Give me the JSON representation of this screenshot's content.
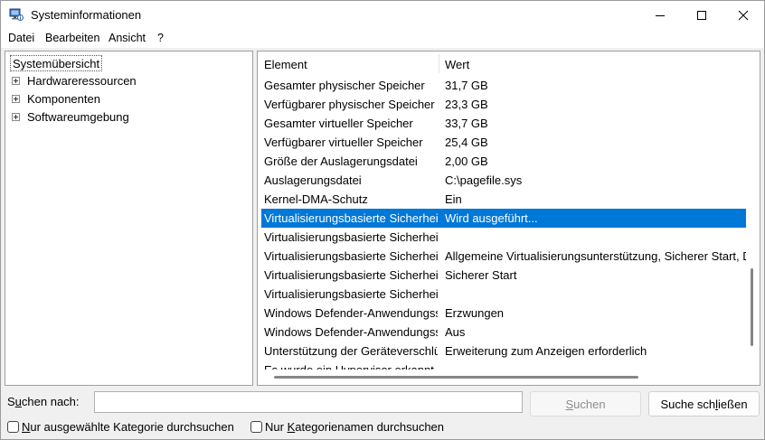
{
  "window": {
    "title": "Systeminformationen",
    "app_icon": "system-info-icon"
  },
  "menu": {
    "items": [
      "Datei",
      "Bearbeiten",
      "Ansicht",
      "?"
    ]
  },
  "tree": {
    "root": "Systemübersicht",
    "nodes": [
      "Hardwareressourcen",
      "Komponenten",
      "Softwareumgebung"
    ]
  },
  "list": {
    "columns": [
      "Element",
      "Wert"
    ],
    "rows": [
      {
        "element": "Gesamter physischer Speicher",
        "wert": "31,7 GB"
      },
      {
        "element": "Verfügbarer physischer Speicher",
        "wert": "23,3 GB"
      },
      {
        "element": "Gesamter virtueller Speicher",
        "wert": "33,7 GB"
      },
      {
        "element": "Verfügbarer virtueller Speicher",
        "wert": "25,4 GB"
      },
      {
        "element": "Größe der Auslagerungsdatei",
        "wert": "2,00 GB"
      },
      {
        "element": "Auslagerungsdatei",
        "wert": "C:\\pagefile.sys"
      },
      {
        "element": "Kernel-DMA-Schutz",
        "wert": "Ein"
      },
      {
        "element": "Virtualisierungsbasierte Sicherheit",
        "wert": "Wird ausgeführt..."
      },
      {
        "element": "Virtualisierungsbasierte Sicherheit",
        "wert": ""
      },
      {
        "element": "Virtualisierungsbasierte Sicherheit",
        "wert": "Allgemeine Virtualisierungsunterstützung, Sicherer Start, DMA-Schutz"
      },
      {
        "element": "Virtualisierungsbasierte Sicherheit",
        "wert": "Sicherer Start"
      },
      {
        "element": "Virtualisierungsbasierte Sicherheit",
        "wert": ""
      },
      {
        "element": "Windows Defender-Anwendungssteuerung",
        "wert": "Erzwungen"
      },
      {
        "element": "Windows Defender-Anwendungssteuerung",
        "wert": "Aus"
      },
      {
        "element": "Unterstützung der Geräteverschlüsselung",
        "wert": "Erweiterung zum Anzeigen erforderlich"
      },
      {
        "element": "Es wurde ein Hypervisor erkannt.",
        "wert": ""
      }
    ],
    "selected_index": 7
  },
  "search": {
    "label_pre": "S",
    "label_u": "u",
    "label_post": "chen nach:",
    "value": "",
    "search_btn_u": "S",
    "search_btn_post": "uchen",
    "close_btn_pre": "Suche sch",
    "close_btn_u": "l",
    "close_btn_post": "ießen",
    "check1_u": "N",
    "check1_post": "ur ausgewählte Kategorie durchsuchen",
    "check2_pre": "Nur ",
    "check2_u": "K",
    "check2_post": "ategorienamen durchsuchen"
  },
  "colors": {
    "selection": "#0078d7"
  }
}
